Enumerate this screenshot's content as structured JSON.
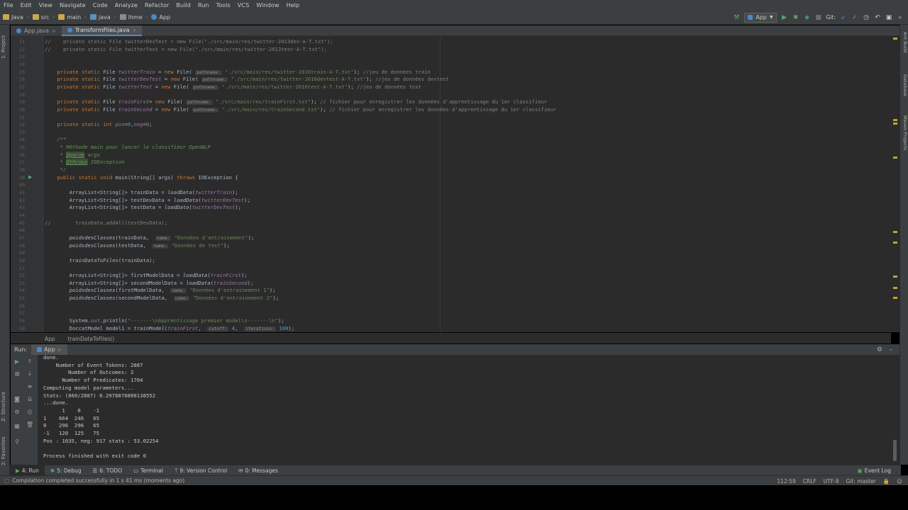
{
  "menu": [
    "File",
    "Edit",
    "View",
    "Navigate",
    "Code",
    "Analyze",
    "Refactor",
    "Build",
    "Run",
    "Tools",
    "VCS",
    "Window",
    "Help"
  ],
  "nav": {
    "crumbs": [
      "Java",
      "src",
      "main",
      "java",
      "ihme",
      "App"
    ],
    "run_config": "App",
    "git_label": "Git:"
  },
  "left_strip": [
    "1: Project",
    "Z: Structure",
    "2: Favorites"
  ],
  "right_strip": [
    "Ant Build",
    "Database",
    "Maven Projects"
  ],
  "tabs": [
    {
      "label": "App.java"
    },
    {
      "label": "TransformFiles.java"
    }
  ],
  "editor": {
    "lines": [
      {
        "n": "21",
        "t": "//    private static File twitterDevTest = new File(\"./src/main/res/twitter-2013dev-A-T.txt\");"
      },
      {
        "n": "22",
        "t": "//    private static File twitterTest = new File(\"./src/main/res/twitter-2013test-A-T.txt\");"
      },
      {
        "n": "23",
        "t": ""
      },
      {
        "n": "24",
        "t": ""
      },
      {
        "n": "25",
        "t": "    private static File twitterTrain = new File( pathname: \"./src/main/res/twitter-2016train-A-T.txt\"); //jeu de données train"
      },
      {
        "n": "26",
        "t": "    private static File twitterDevTest = new File( pathname: \"./src/main/res/twitter-2016devtest-A-T.txt\"); //jeu de données devtest"
      },
      {
        "n": "27",
        "t": "    private static File twitterTest = new File( pathname: \"./src/main/res/twitter-2016test-A-T.txt\"); //jeu de données test"
      },
      {
        "n": "28",
        "t": ""
      },
      {
        "n": "29",
        "t": "    private static File trainFirst= new File( pathname: \"./src/main/res/trainFirst.txt\"); // fichier pour enregistrer les données d'apprentissage du 1er classifieur"
      },
      {
        "n": "30",
        "t": "    private static File trainSecond = new File( pathname: \"./src/main/res/trainSecond.txt\"); // fichier pour enregistrer les données d'apprentissage du 1er classifieur"
      },
      {
        "n": "31",
        "t": ""
      },
      {
        "n": "32",
        "t": "    private static int pos=0,neg=0;"
      },
      {
        "n": "33",
        "t": ""
      },
      {
        "n": "34",
        "t": "    /**"
      },
      {
        "n": "35",
        "t": "     * Méthode main pour lancer le classifieur OpenNLP"
      },
      {
        "n": "36",
        "t": "     * @param args"
      },
      {
        "n": "37",
        "t": "     * @throws IOException"
      },
      {
        "n": "38",
        "t": "     */"
      },
      {
        "n": "39",
        "t": "    public static void main(String[] args) throws IOException {"
      },
      {
        "n": "40",
        "t": ""
      },
      {
        "n": "41",
        "t": "        ArrayList<String[]> trainData = loadData(twitterTrain);"
      },
      {
        "n": "42",
        "t": "        ArrayList<String[]> testDevData = loadData(twitterDevTest);"
      },
      {
        "n": "43",
        "t": "        ArrayList<String[]> testData = loadData(twitterDevTest);"
      },
      {
        "n": "44",
        "t": ""
      },
      {
        "n": "45",
        "t": "//        trainData.addAll(testDevData);"
      },
      {
        "n": "46",
        "t": ""
      },
      {
        "n": "47",
        "t": "        poidsdesClasses(trainData,  name: \"Données d'entrainement\");"
      },
      {
        "n": "48",
        "t": "        poidsdesClasses(testData,  name: \"Données de test\");"
      },
      {
        "n": "49",
        "t": ""
      },
      {
        "n": "50",
        "t": "        trainDataToFiles(trainData);"
      },
      {
        "n": "51",
        "t": ""
      },
      {
        "n": "52",
        "t": "        ArrayList<String[]> firstModelData = loadData(trainFirst);"
      },
      {
        "n": "53",
        "t": "        ArrayList<String[]> secondModelData = loadData(trainSecond);"
      },
      {
        "n": "54",
        "t": "        poidsdesClasses(firstModelData,  name: \"Données d'entrainement 1\");"
      },
      {
        "n": "55",
        "t": "        poidsdesClasses(secondModelData,  name: \"Données d'entrainement 2\");"
      },
      {
        "n": "56",
        "t": ""
      },
      {
        "n": "57",
        "t": ""
      },
      {
        "n": "58",
        "t": "        System.out.println(\"-------\\nApprentissage premier model\\n-------\\n\");"
      },
      {
        "n": "59",
        "t": "        DoccatModel model1 = trainModel(trainFirst,  cutoff: 4,  iterations: 100);"
      }
    ],
    "crumb": [
      "App",
      "trainDataToFiles()"
    ]
  },
  "run": {
    "label": "Run:",
    "config": "App",
    "console": [
      "done.",
      "    Number of Event Tokens: 2887",
      "        Number of Outcomes: 2",
      "      Number of Predicates: 1704",
      "Computing model parameters...",
      "Stats: (860/2887) 0.2978870800138552",
      "...done.",
      "      1    0    -1",
      "1    664  246   65",
      "0    296  296   65",
      "-1   120  125   75",
      "Pos : 1035, neg: 917 stats : 53.02254",
      "",
      "Process finished with exit code 0"
    ]
  },
  "toolbuttons": [
    "4: Run",
    "5: Debug",
    "6: TODO",
    "Terminal",
    "9: Version Control",
    "0: Messages",
    "Event Log"
  ],
  "status": {
    "message": "Compilation completed successfully in 1 s 41 ms (moments ago)",
    "position": "112:59",
    "line_sep": "CRLF",
    "encoding": "UTF-8",
    "git": "Git: master"
  },
  "colors": {
    "accent": "#4a88c7",
    "run_green": "#59a869",
    "folder": "#c9a94d"
  }
}
